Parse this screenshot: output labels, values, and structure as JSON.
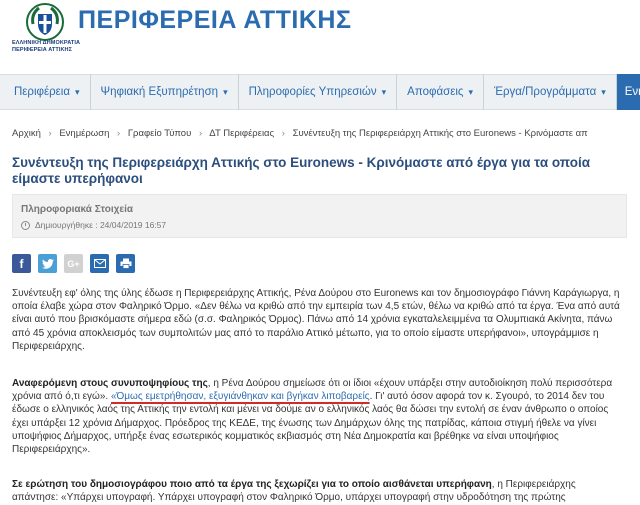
{
  "header": {
    "brand": "ΠΕΡΙΦΕΡΕΙΑ ΑΤΤΙΚΗΣ",
    "logo_sub_line1": "ΕΛΛΗΝΙΚΗ ΔΗΜΟΚΡΑΤΙΑ",
    "logo_sub_line2": "ΠΕΡΙΦΕΡΕΙΑ ΑΤΤΙΚΗΣ"
  },
  "nav": {
    "items": [
      {
        "label": "Περιφέρεια"
      },
      {
        "label": "Ψηφιακή Εξυπηρέτηση"
      },
      {
        "label": "Πληροφορίες Υπηρεσιών"
      },
      {
        "label": "Αποφάσεις"
      },
      {
        "label": "Έργα/Προγράμματα"
      },
      {
        "label": "Ενη"
      }
    ]
  },
  "breadcrumb": {
    "items": [
      "Αρχική",
      "Ενημέρωση",
      "Γραφείο Τύπου",
      "ΔΤ Περιφέρειας",
      "Συνέντευξη της Περιφερειάρχη Αττικής στο Euronews - Κρινόμαστε απ"
    ]
  },
  "article": {
    "title": "Συνέντευξη της Περιφερειάρχη Αττικής στο Euronews - Κρινόμαστε από έργα για τα οποία είμαστε υπερήφανοι",
    "info_label": "Πληροφοριακά Στοιχεία",
    "date": "Δημιουργήθηκε : 24/04/2019 16:57",
    "p1": "Συνέντευξη εφ' όλης της ύλης έδωσε η Περιφερειάρχης Αττικής, Ρένα Δούρου στο Euronews και τον δημοσιογράφο Γιάννη Καράγιωργα, η οποία έλαβε χώρα στον Φαληρικό Όρμο. «Δεν θέλω να κριθώ από την εμπειρία των 4,5 ετών, θέλω να κριθώ από τα έργα. Ένα από αυτά είναι αυτό που βρισκόμαστε σήμερα εδώ (σ.σ. Φαληρικός Όρμος). Πάνω από 14 χρόνια εγκαταλελειμμένα τα Ολυμπιακά Ακίνητα, πάνω από 45 χρόνια αποκλεισμός των συμπολιτών μας από το παράλιο Αττικό μέτωπο, για το οποίο είμαστε υπερήφανοι», υπογράμμισε η Περιφερειάρχης.",
    "p2_bold": "Αναφερόμενη στους συνυποψηφίους της",
    "p2_a": ", η Ρένα Δούρου σημείωσε ότι οι ίδιοι «έχουν υπάρξει στην αυτοδιοίκηση πολύ περισσότερα χρόνια από ό,τι εγώ». ",
    "p2_quote": "«Όμως εμετρήθησαν, εξυγιάνθηκαν και βγήκαν λιποβαρείς",
    "p2_b": ". Γι' αυτό όσον αφορά τον κ. Σγουρό, το 2014 δεν του έδωσε ο ελληνικός λαός της Αττικής την εντολή και μένει να δούμε αν ο ελληνικός λαός θα δώσει την εντολή σε έναν άνθρωπο ο οποίος έχει υπάρξει 12 χρόνια Δήμαρχος. Πρόεδρος της ΚΕΔΕ, της ένωσης των Δημάρχων όλης της πατρίδας, κάποια στιγμή ήθελε να γίνει υποψήφιος Δήμαρχος, υπήρξε ένας εσωτερικός κομματικός εκβιασμός στη Νέα Δημοκρατία και βρέθηκε να είναι υποψήφιος Περιφερειάρχης».",
    "p3_bold": "Σε ερώτηση του δημοσιογράφου ποιο από τα έργα της ξεχωρίζει για το οποίο αισθάνεται υπερήφανη",
    "p3_a": ", η Περιφερειάρχης απάντησε: «Υπάρχει υπογραφή. Υπάρχει υπογραφή στον Φαληρικό Όρμο, υπάρχει υπογραφή στην υδροδότηση της πρώτης"
  },
  "share": {
    "icons": [
      "facebook-icon",
      "twitter-icon",
      "google-plus-icon",
      "email-icon",
      "print-icon"
    ]
  }
}
